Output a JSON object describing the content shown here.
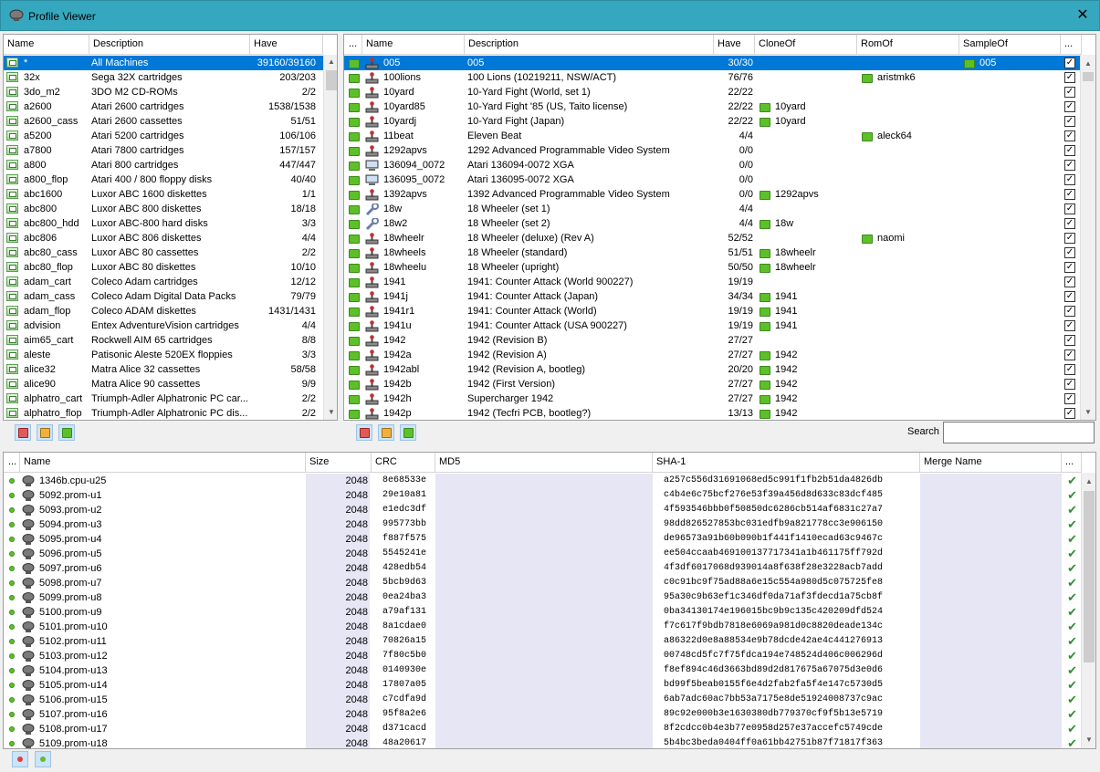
{
  "window": {
    "title": "Profile Viewer",
    "close_glyph": "✕"
  },
  "colors": {
    "title_bar": "#35a8bf",
    "selection": "#0078d7",
    "rom_row_bg": "#e6e6f5",
    "green": "#5dc02b"
  },
  "machine_list": {
    "columns": [
      "Name",
      "Description",
      "Have"
    ],
    "rows": [
      {
        "name": "*",
        "desc": "All Machines",
        "have": "39160/39160",
        "selected": true
      },
      {
        "name": "32x",
        "desc": "Sega 32X cartridges",
        "have": "203/203"
      },
      {
        "name": "3do_m2",
        "desc": "3DO M2 CD-ROMs",
        "have": "2/2"
      },
      {
        "name": "a2600",
        "desc": "Atari 2600 cartridges",
        "have": "1538/1538"
      },
      {
        "name": "a2600_cass",
        "desc": "Atari 2600 cassettes",
        "have": "51/51"
      },
      {
        "name": "a5200",
        "desc": "Atari 5200 cartridges",
        "have": "106/106"
      },
      {
        "name": "a7800",
        "desc": "Atari 7800 cartridges",
        "have": "157/157"
      },
      {
        "name": "a800",
        "desc": "Atari 800 cartridges",
        "have": "447/447"
      },
      {
        "name": "a800_flop",
        "desc": "Atari 400 / 800 floppy disks",
        "have": "40/40"
      },
      {
        "name": "abc1600",
        "desc": "Luxor ABC 1600 diskettes",
        "have": "1/1"
      },
      {
        "name": "abc800",
        "desc": "Luxor ABC 800 diskettes",
        "have": "18/18"
      },
      {
        "name": "abc800_hdd",
        "desc": "Luxor ABC-800 hard disks",
        "have": "3/3"
      },
      {
        "name": "abc806",
        "desc": "Luxor ABC 806 diskettes",
        "have": "4/4"
      },
      {
        "name": "abc80_cass",
        "desc": "Luxor ABC 80 cassettes",
        "have": "2/2"
      },
      {
        "name": "abc80_flop",
        "desc": "Luxor ABC 80 diskettes",
        "have": "10/10"
      },
      {
        "name": "adam_cart",
        "desc": "Coleco Adam cartridges",
        "have": "12/12"
      },
      {
        "name": "adam_cass",
        "desc": "Coleco Adam Digital Data Packs",
        "have": "79/79"
      },
      {
        "name": "adam_flop",
        "desc": "Coleco ADAM diskettes",
        "have": "1431/1431"
      },
      {
        "name": "advision",
        "desc": "Entex AdventureVision cartridges",
        "have": "4/4"
      },
      {
        "name": "aim65_cart",
        "desc": "Rockwell AIM 65 cartridges",
        "have": "8/8"
      },
      {
        "name": "aleste",
        "desc": "Patisonic Aleste 520EX floppies",
        "have": "3/3"
      },
      {
        "name": "alice32",
        "desc": "Matra Alice 32 cassettes",
        "have": "58/58"
      },
      {
        "name": "alice90",
        "desc": "Matra Alice 90 cassettes",
        "have": "9/9"
      },
      {
        "name": "alphatro_cart",
        "desc": "Triumph-Adler Alphatronic PC car...",
        "have": "2/2"
      },
      {
        "name": "alphatro_flop",
        "desc": "Triumph-Adler Alphatronic PC dis...",
        "have": "2/2"
      }
    ]
  },
  "game_list": {
    "columns": [
      "...",
      "Name",
      "Description",
      "Have",
      "CloneOf",
      "RomOf",
      "SampleOf",
      "..."
    ],
    "rows": [
      {
        "icon": "joystick-icon",
        "name": "005",
        "desc": "005",
        "have": "30/30",
        "cloneof": "",
        "romof": "",
        "sampleof": "005",
        "selected": true
      },
      {
        "icon": "joystick-icon",
        "name": "100lions",
        "desc": "100 Lions (10219211, NSW/ACT)",
        "have": "76/76",
        "cloneof": "",
        "romof": "aristmk6",
        "sampleof": ""
      },
      {
        "icon": "joystick-icon",
        "name": "10yard",
        "desc": "10-Yard Fight (World, set 1)",
        "have": "22/22",
        "cloneof": "",
        "romof": "",
        "sampleof": ""
      },
      {
        "icon": "joystick-icon",
        "name": "10yard85",
        "desc": "10-Yard Fight '85 (US, Taito license)",
        "have": "22/22",
        "cloneof": "10yard",
        "romof": "",
        "sampleof": ""
      },
      {
        "icon": "joystick-icon",
        "name": "10yardj",
        "desc": "10-Yard Fight (Japan)",
        "have": "22/22",
        "cloneof": "10yard",
        "romof": "",
        "sampleof": ""
      },
      {
        "icon": "joystick-icon",
        "name": "11beat",
        "desc": "Eleven Beat",
        "have": "4/4",
        "cloneof": "",
        "romof": "aleck64",
        "sampleof": ""
      },
      {
        "icon": "joystick-icon",
        "name": "1292apvs",
        "desc": "1292 Advanced Programmable Video System",
        "have": "0/0",
        "cloneof": "",
        "romof": "",
        "sampleof": ""
      },
      {
        "icon": "computer-icon",
        "name": "136094_0072",
        "desc": "Atari 136094-0072 XGA",
        "have": "0/0",
        "cloneof": "",
        "romof": "",
        "sampleof": ""
      },
      {
        "icon": "computer-icon",
        "name": "136095_0072",
        "desc": "Atari 136095-0072 XGA",
        "have": "0/0",
        "cloneof": "",
        "romof": "",
        "sampleof": ""
      },
      {
        "icon": "joystick-icon",
        "name": "1392apvs",
        "desc": "1392 Advanced Programmable Video System",
        "have": "0/0",
        "cloneof": "1292apvs",
        "romof": "",
        "sampleof": ""
      },
      {
        "icon": "wrench-icon",
        "name": "18w",
        "desc": "18 Wheeler (set 1)",
        "have": "4/4",
        "cloneof": "",
        "romof": "",
        "sampleof": ""
      },
      {
        "icon": "wrench-icon",
        "name": "18w2",
        "desc": "18 Wheeler (set 2)",
        "have": "4/4",
        "cloneof": "18w",
        "romof": "",
        "sampleof": ""
      },
      {
        "icon": "joystick-icon",
        "name": "18wheelr",
        "desc": "18 Wheeler (deluxe) (Rev A)",
        "have": "52/52",
        "cloneof": "",
        "romof": "naomi",
        "sampleof": ""
      },
      {
        "icon": "joystick-icon",
        "name": "18wheels",
        "desc": "18 Wheeler (standard)",
        "have": "51/51",
        "cloneof": "18wheelr",
        "romof": "",
        "sampleof": ""
      },
      {
        "icon": "joystick-icon",
        "name": "18wheelu",
        "desc": "18 Wheeler (upright)",
        "have": "50/50",
        "cloneof": "18wheelr",
        "romof": "",
        "sampleof": ""
      },
      {
        "icon": "joystick-icon",
        "name": "1941",
        "desc": "1941: Counter Attack (World 900227)",
        "have": "19/19",
        "cloneof": "",
        "romof": "",
        "sampleof": ""
      },
      {
        "icon": "joystick-icon",
        "name": "1941j",
        "desc": "1941: Counter Attack (Japan)",
        "have": "34/34",
        "cloneof": "1941",
        "romof": "",
        "sampleof": ""
      },
      {
        "icon": "joystick-icon",
        "name": "1941r1",
        "desc": "1941: Counter Attack (World)",
        "have": "19/19",
        "cloneof": "1941",
        "romof": "",
        "sampleof": ""
      },
      {
        "icon": "joystick-icon",
        "name": "1941u",
        "desc": "1941: Counter Attack (USA 900227)",
        "have": "19/19",
        "cloneof": "1941",
        "romof": "",
        "sampleof": ""
      },
      {
        "icon": "joystick-icon",
        "name": "1942",
        "desc": "1942 (Revision B)",
        "have": "27/27",
        "cloneof": "",
        "romof": "",
        "sampleof": ""
      },
      {
        "icon": "joystick-icon",
        "name": "1942a",
        "desc": "1942 (Revision A)",
        "have": "27/27",
        "cloneof": "1942",
        "romof": "",
        "sampleof": ""
      },
      {
        "icon": "joystick-icon",
        "name": "1942abl",
        "desc": "1942 (Revision A, bootleg)",
        "have": "20/20",
        "cloneof": "1942",
        "romof": "",
        "sampleof": ""
      },
      {
        "icon": "joystick-icon",
        "name": "1942b",
        "desc": "1942 (First Version)",
        "have": "27/27",
        "cloneof": "1942",
        "romof": "",
        "sampleof": ""
      },
      {
        "icon": "joystick-icon",
        "name": "1942h",
        "desc": "Supercharger 1942",
        "have": "27/27",
        "cloneof": "1942",
        "romof": "",
        "sampleof": ""
      },
      {
        "icon": "joystick-icon",
        "name": "1942p",
        "desc": "1942 (Tecfri PCB, bootleg?)",
        "have": "13/13",
        "cloneof": "1942",
        "romof": "",
        "sampleof": ""
      }
    ]
  },
  "search": {
    "label": "Search",
    "value": ""
  },
  "rom_list": {
    "columns": [
      "...",
      "Name",
      "Size",
      "CRC",
      "MD5",
      "SHA-1",
      "Merge Name",
      "..."
    ],
    "rows": [
      {
        "name": "1346b.cpu-u25",
        "size": "2048",
        "crc": "8e68533e",
        "md5": "",
        "sha1": "a257c556d31691068ed5c991f1fb2b51da4826db",
        "merge": ""
      },
      {
        "name": "5092.prom-u1",
        "size": "2048",
        "crc": "29e10a81",
        "md5": "",
        "sha1": "c4b4e6c75bcf276e53f39a456d8d633c83dcf485",
        "merge": ""
      },
      {
        "name": "5093.prom-u2",
        "size": "2048",
        "crc": "e1edc3df",
        "md5": "",
        "sha1": "4f593546bbb0f50850dc6286cb514af6831c27a7",
        "merge": ""
      },
      {
        "name": "5094.prom-u3",
        "size": "2048",
        "crc": "995773bb",
        "md5": "",
        "sha1": "98dd826527853bc031edfb9a821778cc3e906150",
        "merge": ""
      },
      {
        "name": "5095.prom-u4",
        "size": "2048",
        "crc": "f887f575",
        "md5": "",
        "sha1": "de96573a91b60b090b1f441f1410ecad63c9467c",
        "merge": ""
      },
      {
        "name": "5096.prom-u5",
        "size": "2048",
        "crc": "5545241e",
        "md5": "",
        "sha1": "ee504ccaab469100137717341a1b461175ff792d",
        "merge": ""
      },
      {
        "name": "5097.prom-u6",
        "size": "2048",
        "crc": "428edb54",
        "md5": "",
        "sha1": "4f3df6017068d939014a8f638f28e3228acb7add",
        "merge": ""
      },
      {
        "name": "5098.prom-u7",
        "size": "2048",
        "crc": "5bcb9d63",
        "md5": "",
        "sha1": "c0c91bc9f75ad88a6e15c554a980d5c075725fe8",
        "merge": ""
      },
      {
        "name": "5099.prom-u8",
        "size": "2048",
        "crc": "0ea24ba3",
        "md5": "",
        "sha1": "95a30c9b63ef1c346df0da71af3fdecd1a75cb8f",
        "merge": ""
      },
      {
        "name": "5100.prom-u9",
        "size": "2048",
        "crc": "a79af131",
        "md5": "",
        "sha1": "0ba34130174e196015bc9b9c135c420209dfd524",
        "merge": ""
      },
      {
        "name": "5101.prom-u10",
        "size": "2048",
        "crc": "8a1cdae0",
        "md5": "",
        "sha1": "f7c617f9bdb7818e6069a981d0c8820deade134c",
        "merge": ""
      },
      {
        "name": "5102.prom-u11",
        "size": "2048",
        "crc": "70826a15",
        "md5": "",
        "sha1": "a86322d0e8a88534e9b78dcde42ae4c441276913",
        "merge": ""
      },
      {
        "name": "5103.prom-u12",
        "size": "2048",
        "crc": "7f80c5b0",
        "md5": "",
        "sha1": "00748cd5fc7f75fdca194e748524d406c006296d",
        "merge": ""
      },
      {
        "name": "5104.prom-u13",
        "size": "2048",
        "crc": "0140930e",
        "md5": "",
        "sha1": "f8ef894c46d3663bd89d2d817675a67075d3e0d6",
        "merge": ""
      },
      {
        "name": "5105.prom-u14",
        "size": "2048",
        "crc": "17807a05",
        "md5": "",
        "sha1": "bd99f5beab0155f6e4d2fab2fa5f4e147c5730d5",
        "merge": ""
      },
      {
        "name": "5106.prom-u15",
        "size": "2048",
        "crc": "c7cdfa9d",
        "md5": "",
        "sha1": "6ab7adc60ac7bb53a7175e8de51924008737c9ac",
        "merge": ""
      },
      {
        "name": "5107.prom-u16",
        "size": "2048",
        "crc": "95f8a2e6",
        "md5": "",
        "sha1": "89c92e000b3e1630380db779370cf9f5b13e5719",
        "merge": ""
      },
      {
        "name": "5108.prom-u17",
        "size": "2048",
        "crc": "d371cacd",
        "md5": "",
        "sha1": "8f2cdcc0b4e3b77e0958d257e37accefc5749cde",
        "merge": ""
      },
      {
        "name": "5109.prom-u18",
        "size": "2048",
        "crc": "48a20617",
        "md5": "",
        "sha1": "5b4bc3beda0404ff0a61bb42751b87f71817f363",
        "merge": ""
      }
    ]
  }
}
